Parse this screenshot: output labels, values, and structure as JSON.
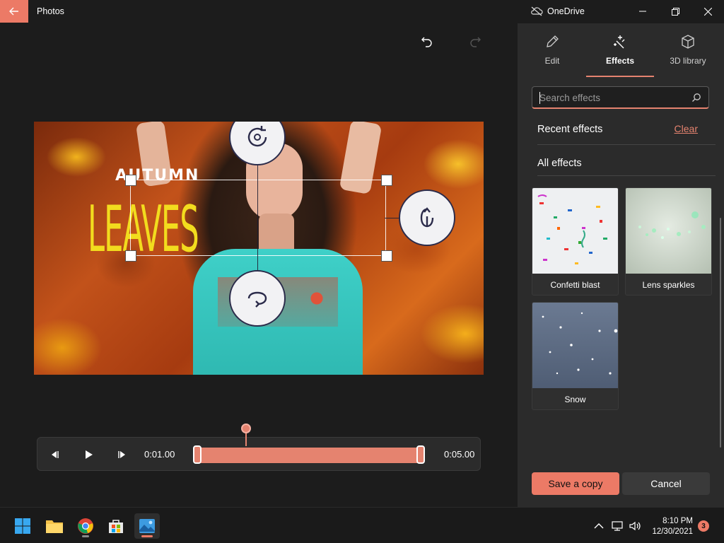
{
  "app": {
    "title": "Photos",
    "cloud_label": "OneDrive"
  },
  "canvas": {
    "text_overlay_1": "AUTUMN",
    "text_overlay_2": "LEAVES"
  },
  "timeline": {
    "current_time": "0:01.00",
    "end_time": "0:05.00"
  },
  "panel": {
    "tabs": [
      {
        "label": "Edit",
        "icon": "pencil-icon"
      },
      {
        "label": "Effects",
        "icon": "effects-sparkle-icon"
      },
      {
        "label": "3D library",
        "icon": "cube-icon"
      }
    ],
    "search": {
      "placeholder": "Search effects",
      "value": ""
    },
    "recent_title": "Recent effects",
    "clear_label": "Clear",
    "all_title": "All effects",
    "effects": [
      {
        "label": "Confetti blast"
      },
      {
        "label": "Lens sparkles"
      },
      {
        "label": "Snow"
      }
    ],
    "save_label": "Save a copy",
    "cancel_label": "Cancel"
  },
  "taskbar": {
    "apps": [
      "start-icon",
      "file-explorer-icon",
      "chrome-icon",
      "store-icon",
      "photos-icon"
    ],
    "time": "8:10 PM",
    "date": "12/30/2021",
    "notification_count": "3"
  },
  "colors": {
    "accent": "#ec7a66",
    "panel_bg": "#2b2b2b",
    "canvas_bg": "#1c1c1c"
  }
}
